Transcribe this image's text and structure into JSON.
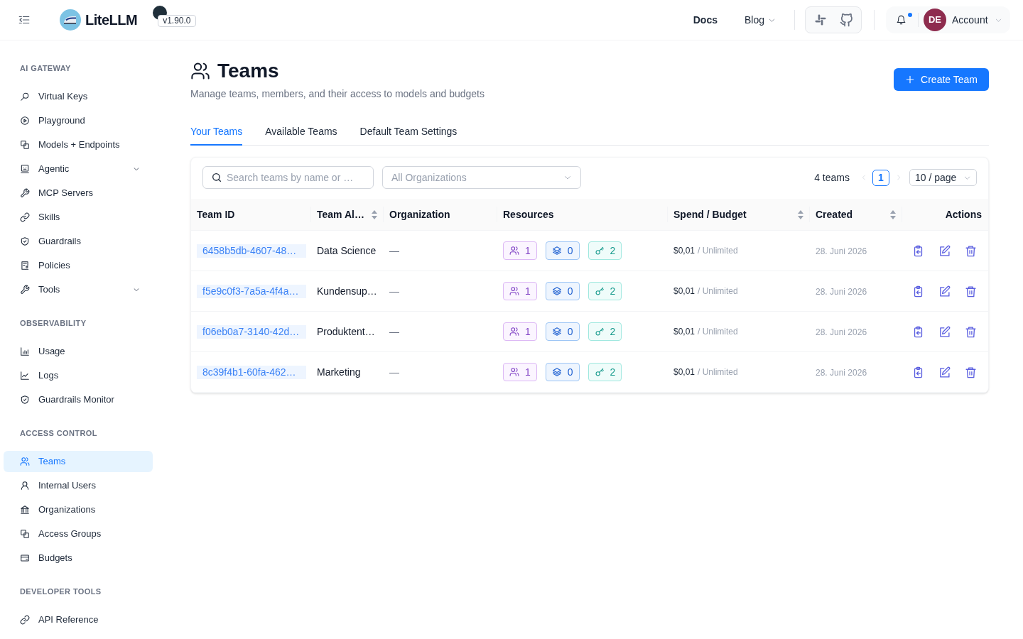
{
  "header": {
    "brand": "LiteLLM",
    "version": "v1.90.0",
    "nav": [
      {
        "label": "Docs",
        "kind": "link"
      },
      {
        "label": "Blog",
        "kind": "dropdown"
      }
    ],
    "notifications": {
      "unread": true
    },
    "account": {
      "initials": "DE",
      "label": "Account"
    }
  },
  "sidebar": {
    "sections": [
      {
        "title": "AI GATEWAY",
        "items": [
          {
            "label": "Virtual Keys",
            "kind": "link",
            "selected": false
          },
          {
            "label": "Playground",
            "kind": "link",
            "selected": false
          },
          {
            "label": "Models + Endpoints",
            "kind": "link",
            "selected": false
          },
          {
            "label": "Agentic",
            "kind": "submenu",
            "selected": false
          },
          {
            "label": "MCP Servers",
            "kind": "link",
            "selected": false
          },
          {
            "label": "Skills",
            "kind": "link",
            "selected": false
          },
          {
            "label": "Guardrails",
            "kind": "link",
            "selected": false
          },
          {
            "label": "Policies",
            "kind": "link",
            "selected": false
          },
          {
            "label": "Tools",
            "kind": "submenu",
            "selected": false
          }
        ]
      },
      {
        "title": "OBSERVABILITY",
        "items": [
          {
            "label": "Usage",
            "kind": "link",
            "selected": false
          },
          {
            "label": "Logs",
            "kind": "link",
            "selected": false
          },
          {
            "label": "Guardrails Monitor",
            "kind": "link",
            "selected": false
          }
        ]
      },
      {
        "title": "ACCESS CONTROL",
        "items": [
          {
            "label": "Teams",
            "kind": "link",
            "selected": true
          },
          {
            "label": "Internal Users",
            "kind": "link",
            "selected": false
          },
          {
            "label": "Organizations",
            "kind": "link",
            "selected": false
          },
          {
            "label": "Access Groups",
            "kind": "link",
            "selected": false
          },
          {
            "label": "Budgets",
            "kind": "link",
            "selected": false
          }
        ]
      },
      {
        "title": "DEVELOPER TOOLS",
        "items": [
          {
            "label": "API Reference",
            "kind": "link",
            "selected": false
          }
        ]
      }
    ]
  },
  "page": {
    "title": "Teams",
    "subtitle": "Manage teams, members, and their access to models and budgets",
    "primary_action": "Create Team"
  },
  "tabs": [
    {
      "label": "Your Teams",
      "selected": true
    },
    {
      "label": "Available Teams",
      "selected": false
    },
    {
      "label": "Default Team Settings",
      "selected": false
    }
  ],
  "filters": {
    "search": {
      "placeholder": "Search teams by name or …"
    },
    "organization": {
      "placeholder": "All Organizations"
    }
  },
  "pagination": {
    "total": "4 teams",
    "prev_disabled": true,
    "next_disabled": true,
    "pages": [
      {
        "label": "1",
        "selected": true
      }
    ],
    "page_size": "10 / page"
  },
  "table": {
    "columns": [
      {
        "label": "Team ID",
        "sortable": false
      },
      {
        "label": "Team Al…",
        "sortable": true
      },
      {
        "label": "Organization",
        "sortable": false
      },
      {
        "label": "Resources",
        "sortable": false
      },
      {
        "label": "Spend / Budget",
        "sortable": true
      },
      {
        "label": "Created",
        "sortable": true
      },
      {
        "label": "Actions",
        "sortable": false
      }
    ],
    "rows": [
      {
        "team_id": "6458b5db-4607-48…",
        "alias": "Data Science",
        "organization": "—",
        "members": "1",
        "models": "0",
        "keys": "2",
        "spend": "$0,01",
        "budget": "/ Unlimited",
        "created": "28. Juni 2026"
      },
      {
        "team_id": "f5e9c0f3-7a5a-4f4a…",
        "alias": "Kundensup…",
        "organization": "—",
        "members": "1",
        "models": "0",
        "keys": "2",
        "spend": "$0,01",
        "budget": "/ Unlimited",
        "created": "28. Juni 2026"
      },
      {
        "team_id": "f06eb0a7-3140-42d…",
        "alias": "Produktent…",
        "organization": "—",
        "members": "1",
        "models": "0",
        "keys": "2",
        "spend": "$0,01",
        "budget": "/ Unlimited",
        "created": "28. Juni 2026"
      },
      {
        "team_id": "8c39f4b1-60fa-462…",
        "alias": "Marketing",
        "organization": "—",
        "members": "1",
        "models": "0",
        "keys": "2",
        "spend": "$0,01",
        "budget": "/ Unlimited",
        "created": "28. Juni 2026"
      }
    ]
  }
}
